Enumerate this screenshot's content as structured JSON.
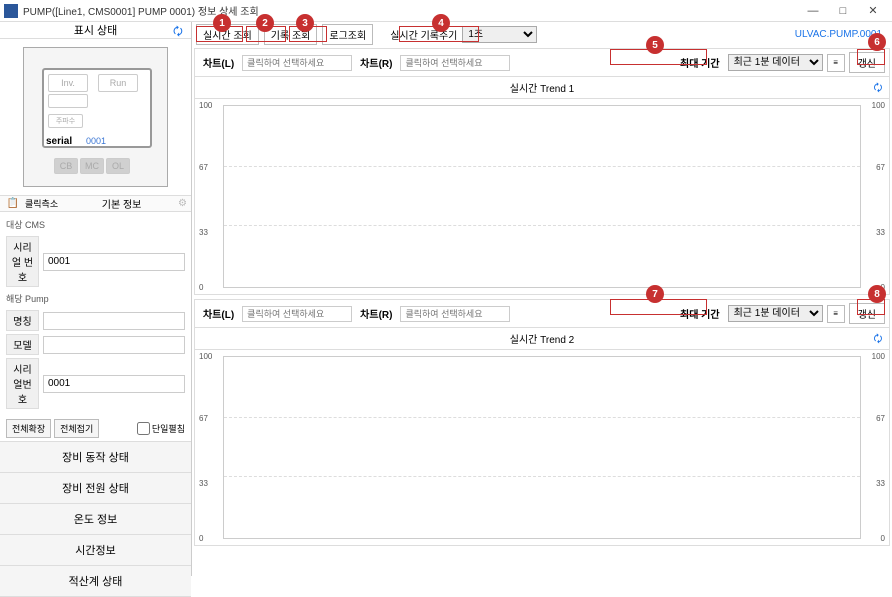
{
  "window": {
    "title": "PUMP([Line1, CMS0001] PUMP 0001) 정보 상세 조회"
  },
  "sidebar": {
    "header": "표시 상태",
    "pump_diagram": {
      "inv": "Inv.",
      "run": "Run",
      "freq": "주파수",
      "serial_label": "serial",
      "serial_value": "0001",
      "cb": "CB",
      "mc": "MC",
      "ol": "OL"
    },
    "click_axis_label": "클릭측소",
    "basic_info_label": "기본 정보",
    "cms_section": "대상 CMS",
    "serial_number_label": "시리얼 번호",
    "serial_number_value": "0001",
    "pump_section": "해당 Pump",
    "name_label": "명칭",
    "name_value": "",
    "model_label": "모델",
    "model_value": "",
    "serial2_label": "시리얼번호",
    "serial2_value": "0001",
    "expand_all": "전체확장",
    "collapse_all": "전체접기",
    "single_open": "단일펼침",
    "nav": [
      "장비 동작 상태",
      "장비 전원 상태",
      "온도 정보",
      "시간정보",
      "적산계 상태"
    ]
  },
  "tabs": {
    "realtime": "실시간 조회",
    "record": "기록 조회",
    "log": "로그조회",
    "interval_label": "실시간 기록주기",
    "interval_value": "1초",
    "right_link": "ULVAC.PUMP.0001"
  },
  "chart1": {
    "chartL_label": "차트(L)",
    "chartL_placeholder": "클릭하여 선택하세요",
    "chartR_label": "차트(R)",
    "chartR_placeholder": "클릭하여 선택하세요",
    "period_label": "최대 기간",
    "period_value": "최근 1분 데이터",
    "refresh": "갱신",
    "trend_title": "실시간 Trend 1"
  },
  "chart2": {
    "chartL_label": "차트(L)",
    "chartL_placeholder": "클릭하여 선택하세요",
    "chartR_label": "차트(R)",
    "chartR_placeholder": "클릭하여 선택하세요",
    "period_label": "최대 기간",
    "period_value": "최근 1분 데이터",
    "refresh": "갱신",
    "trend_title": "실시간 Trend 2"
  },
  "chart_data": {
    "type": "line",
    "series": [],
    "ylim_left": [
      0,
      100
    ],
    "ylim_right": [
      0,
      100
    ],
    "yticks": [
      0,
      33,
      67,
      100
    ]
  },
  "callouts": [
    "1",
    "2",
    "3",
    "4",
    "5",
    "6",
    "7",
    "8"
  ]
}
